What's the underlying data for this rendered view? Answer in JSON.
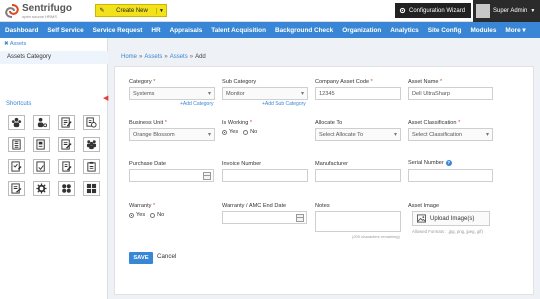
{
  "brand": {
    "name": "Sentrifugo",
    "tagline": "open source HRMS"
  },
  "header": {
    "create_new": "Create New",
    "config_wizard": "Configuration Wizard",
    "user_name": "Super Admin"
  },
  "nav": {
    "items": [
      "Dashboard",
      "Self Service",
      "Service Request",
      "HR",
      "Appraisals",
      "Talent Acquisition",
      "Background Check",
      "Organization",
      "Analytics",
      "Site Config",
      "Modules",
      "More ▾"
    ]
  },
  "sidebar": {
    "section_title": "✖ Assets",
    "active_item": "Assets Category",
    "shortcuts_title": "Shortcuts",
    "shortcut_icons": [
      "people-group-icon",
      "user-gear-icon",
      "edit-form-icon",
      "document-clock-icon",
      "list-document-icon",
      "calendar-document-icon",
      "edit-document-icon",
      "team-icon",
      "checklist-icon",
      "note-check-icon",
      "document-edit-icon",
      "clipboard-icon",
      "form-icon",
      "gear-icon",
      "grid-apps-icon",
      "grid-tiles-icon"
    ]
  },
  "breadcrumb": {
    "items": [
      "Home",
      "Assets",
      "Assets"
    ],
    "current": "Add"
  },
  "form": {
    "category": {
      "label": "Category",
      "value": "Systems",
      "add_link": "+Add Category"
    },
    "sub_category": {
      "label": "Sub Category",
      "value": "Monitor",
      "add_link": "+Add Sub Category"
    },
    "asset_code": {
      "label": "Company Asset Code",
      "value": "12345"
    },
    "asset_name": {
      "label": "Asset Name",
      "value": "Dell UltraSharp"
    },
    "business_unit": {
      "label": "Business Unit",
      "value": "Orange Blossom"
    },
    "is_working": {
      "label": "Is Working",
      "yes": "Yes",
      "no": "No",
      "selected": "Yes"
    },
    "allocate_to": {
      "label": "Allocate To",
      "value": "Select Allocate To"
    },
    "asset_classification": {
      "label": "Asset Classification",
      "value": "Select Classification"
    },
    "purchase_date": {
      "label": "Purchase Date",
      "value": ""
    },
    "invoice_number": {
      "label": "Invoice Number",
      "value": ""
    },
    "manufacturer": {
      "label": "Manufacturer",
      "value": ""
    },
    "serial_number": {
      "label": "Serial Number",
      "value": ""
    },
    "warranty": {
      "label": "Warranty",
      "yes": "Yes",
      "no": "No",
      "selected": "Yes"
    },
    "warranty_end": {
      "label": "Warranty / AMC End Date",
      "value": ""
    },
    "notes": {
      "label": "Notes",
      "counter": "(200 characters remaining)"
    },
    "asset_image": {
      "label": "Asset Image",
      "button": "Upload Image(s)",
      "formats": "Allowed Formats : .jpg, png, jpeg, gif)"
    },
    "save": "SAVE",
    "cancel": "Cancel"
  },
  "colors": {
    "accent": "#3a86d6",
    "create_button": "#f3e11b",
    "required": "#e23d3d"
  }
}
